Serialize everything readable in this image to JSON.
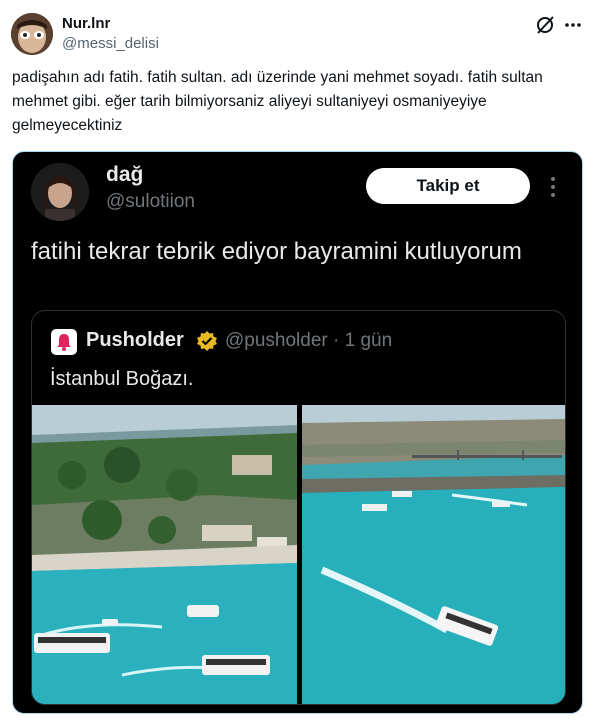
{
  "tweet": {
    "author_name": "Nur.lnr",
    "author_handle": "@messi_delisi",
    "text": "padişahın adı fatih. fatih sultan. adı üzerinde yani mehmet soyadı. fatih sultan mehmet gibi. eğer tarih bilmiyorsaniz aliyeyi sultaniyeyi osmaniyeyiye gelmeyecektiniz",
    "icons": {
      "grok": "grok-slash-icon",
      "more": "more-horizontal-icon"
    }
  },
  "embedded": {
    "author_name": "dağ",
    "author_handle": "@sulotiion",
    "follow_label": "Takip et",
    "text": "fatihi tekrar tebrik ediyor bayramini kutluyorum",
    "quoted": {
      "author_name": "Pusholder",
      "author_handle": "@pusholder",
      "time": "· 1 gün",
      "text": "İstanbul Boğazı.",
      "verified_color": "#e8b923",
      "photos": [
        "aerial-bosphorus-historic-peninsula-ferries",
        "aerial-golden-horn-bridge-ferry"
      ]
    }
  },
  "colors": {
    "embed_bg": "#000000",
    "embed_border": "#a8d8f0",
    "text_dark": "#0f1419",
    "text_muted": "#536471",
    "text_light": "#e7e9ea",
    "muted_dark": "#71767b",
    "sea": "#2fb5c0"
  }
}
